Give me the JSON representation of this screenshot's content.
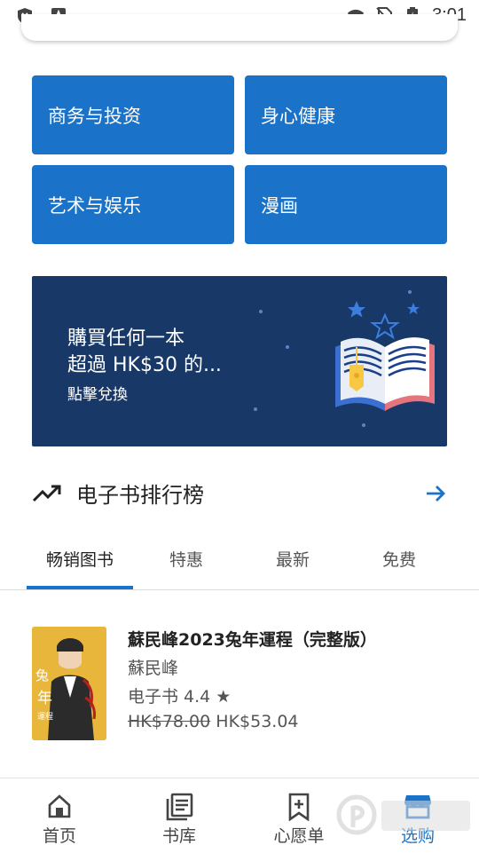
{
  "status_bar": {
    "time": "3:01"
  },
  "categories": [
    {
      "label": "商务与投资"
    },
    {
      "label": "身心健康"
    },
    {
      "label": "艺术与娱乐"
    },
    {
      "label": "漫画"
    }
  ],
  "banner": {
    "line1": "購買任何一本",
    "line2": "超過 HK$30 的...",
    "cta": "點擊兌換"
  },
  "ranking": {
    "title": "电子书排行榜",
    "tabs": [
      "畅销图书",
      "特惠",
      "最新",
      "免费"
    ],
    "active_tab": "畅销图书"
  },
  "book": {
    "title": "蘇民峰2023兔年運程（完整版）",
    "author": "蘇民峰",
    "rating_text": "电子书 4.4 ★",
    "price_original": "HK$78.00",
    "price_sale": "HK$53.04"
  },
  "bottom_nav": [
    {
      "label": "首页",
      "icon": "home-icon"
    },
    {
      "label": "书库",
      "icon": "library-icon"
    },
    {
      "label": "心愿单",
      "icon": "wishlist-icon"
    },
    {
      "label": "选购",
      "icon": "shop-icon"
    }
  ],
  "colors": {
    "accent": "#1a73c8",
    "banner_bg": "#183868"
  }
}
